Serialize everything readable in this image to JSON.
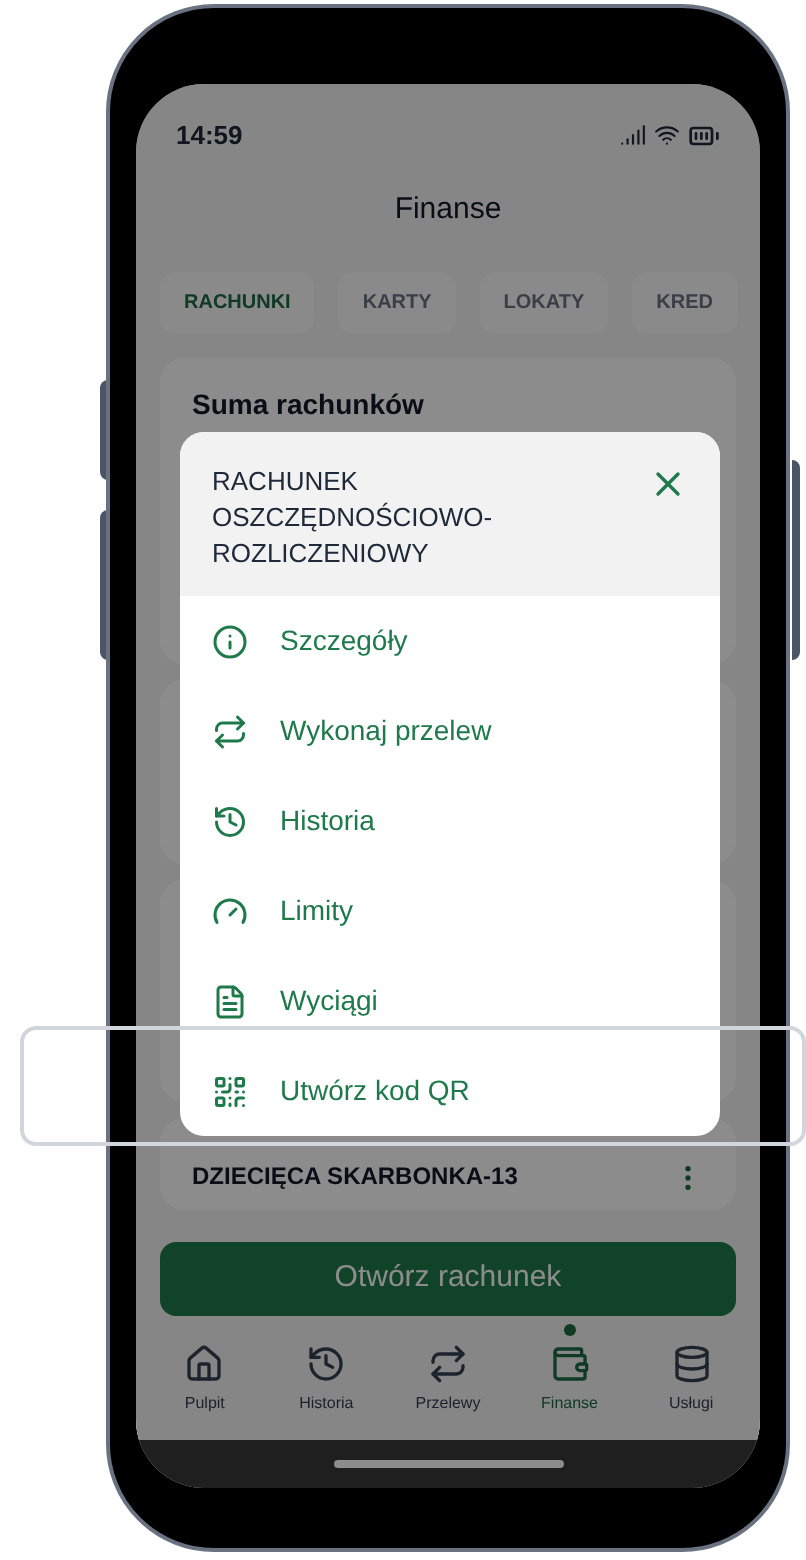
{
  "status_bar": {
    "time": "14:59"
  },
  "header": {
    "title": "Finanse"
  },
  "tabs": [
    {
      "label": "RACHUNKI",
      "selected": true
    },
    {
      "label": "KARTY",
      "selected": false
    },
    {
      "label": "LOKATY",
      "selected": false
    },
    {
      "label": "KRED",
      "selected": false
    }
  ],
  "summary_card": {
    "title": "Suma rachunków"
  },
  "account_row": {
    "name": "DZIECIĘCA SKARBONKA-13"
  },
  "primary_button": {
    "label": "Otwórz rachunek"
  },
  "bottom_nav": [
    {
      "label": "Pulpit",
      "kind": "home",
      "selected": false
    },
    {
      "label": "Historia",
      "kind": "history",
      "selected": false
    },
    {
      "label": "Przelewy",
      "kind": "transfer",
      "selected": false
    },
    {
      "label": "Finanse",
      "kind": "wallet",
      "selected": true
    },
    {
      "label": "Usługi",
      "kind": "services",
      "selected": false
    }
  ],
  "menu": {
    "title": "RACHUNEK OSZCZĘDNOŚCIOWO-ROZLICZENIOWY",
    "items": [
      {
        "label": "Szczegóły",
        "kind": "info",
        "highlighted": false
      },
      {
        "label": "Wykonaj przelew",
        "kind": "transfer",
        "highlighted": false
      },
      {
        "label": "Historia",
        "kind": "history",
        "highlighted": false
      },
      {
        "label": "Limity",
        "kind": "limits",
        "highlighted": false
      },
      {
        "label": "Wyciągi",
        "kind": "statements",
        "highlighted": false
      },
      {
        "label": "Utwórz kod QR",
        "kind": "qr",
        "highlighted": true
      }
    ]
  }
}
